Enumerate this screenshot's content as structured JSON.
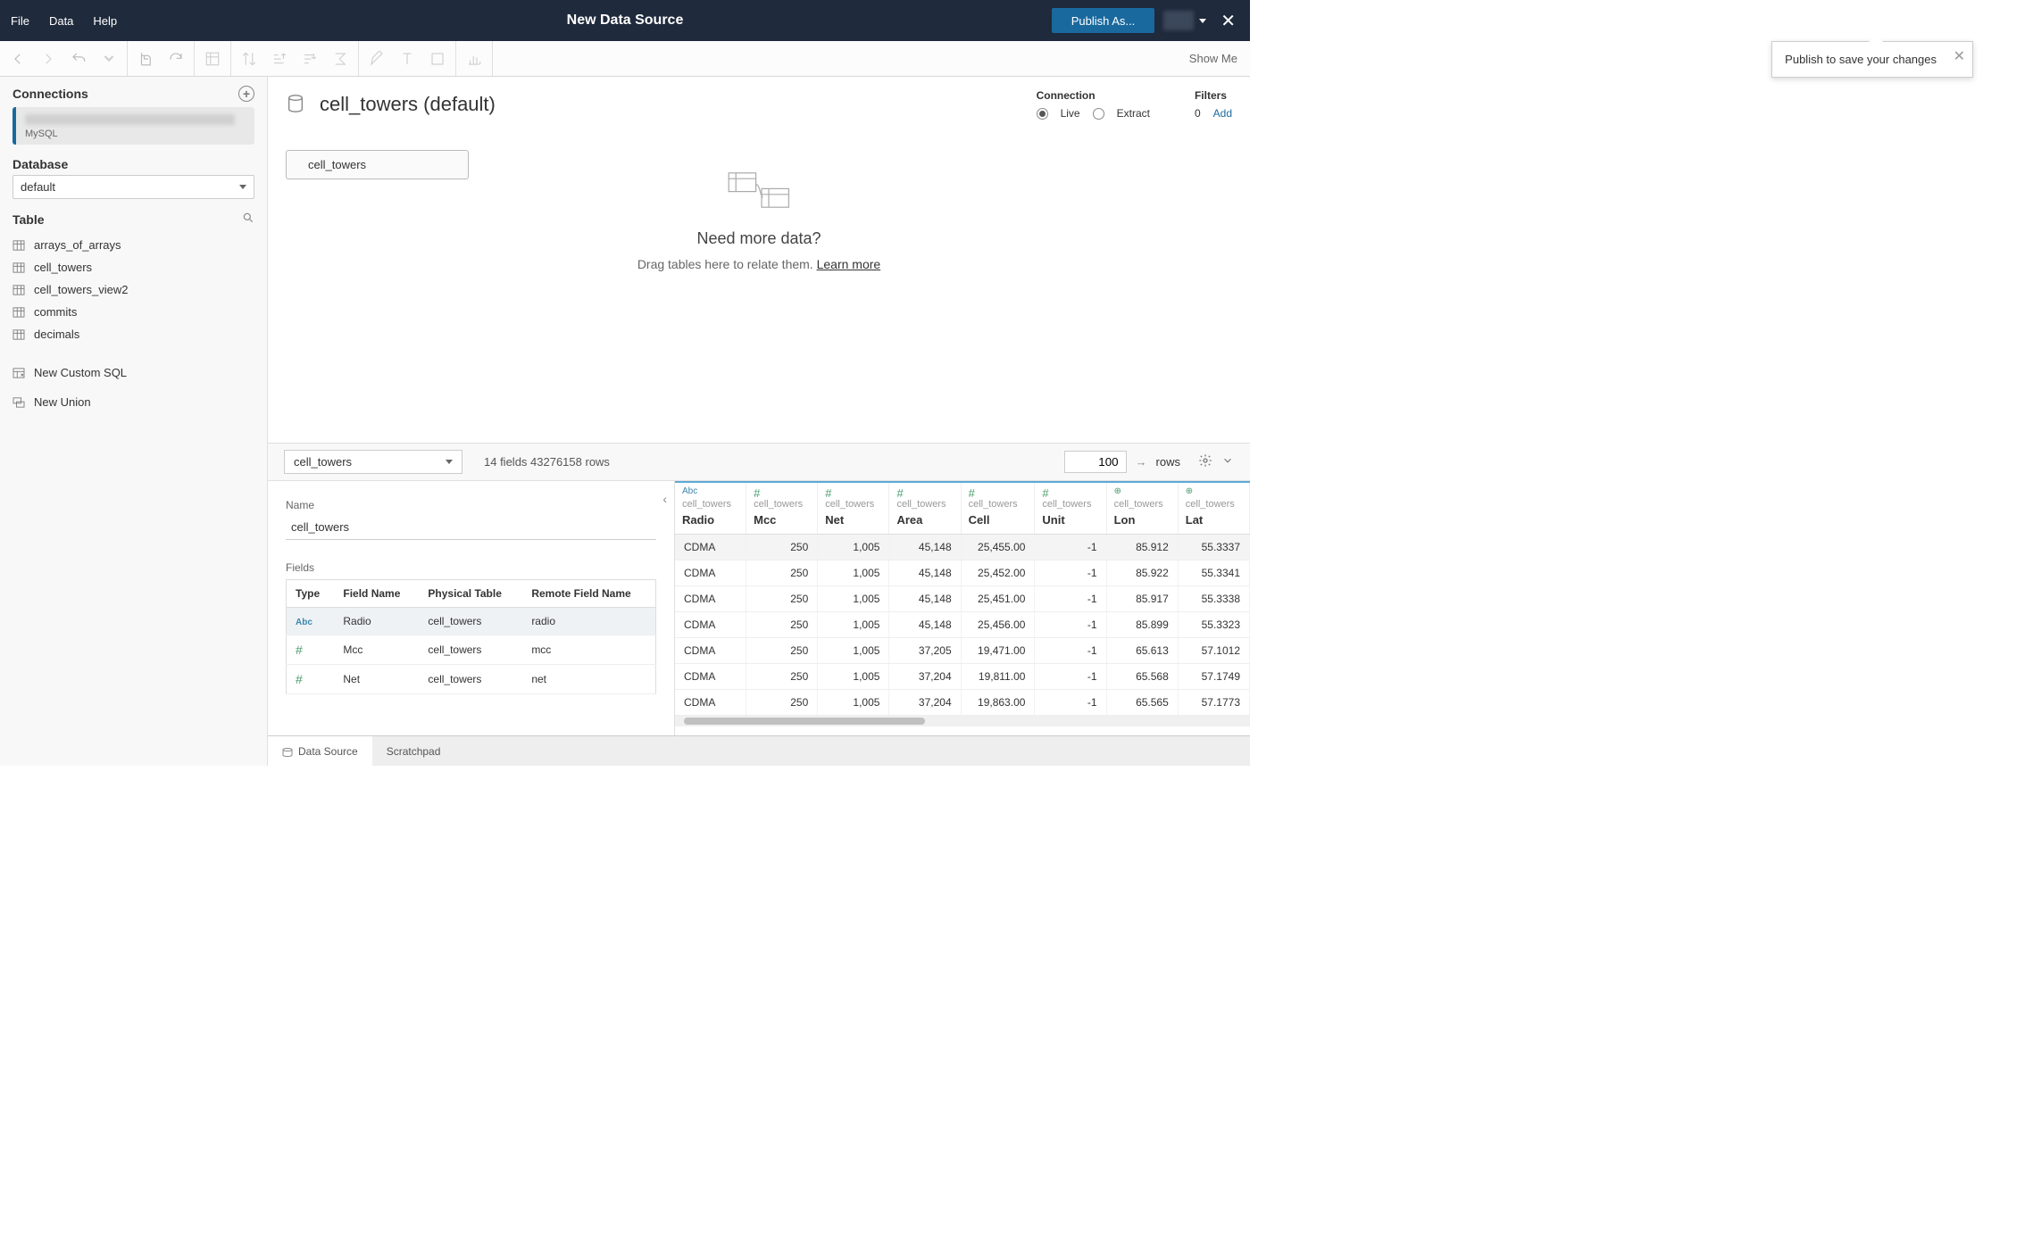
{
  "menubar": {
    "file": "File",
    "data": "Data",
    "help": "Help",
    "title": "New Data Source",
    "publish": "Publish As..."
  },
  "tooltip": {
    "text": "Publish to save your changes"
  },
  "toolbar": {
    "show_me": "Show Me"
  },
  "sidebar": {
    "connections": {
      "label": "Connections",
      "items": [
        {
          "type": "MySQL"
        }
      ]
    },
    "database": {
      "label": "Database",
      "value": "default"
    },
    "table": {
      "label": "Table",
      "items": [
        "arrays_of_arrays",
        "cell_towers",
        "cell_towers_view2",
        "commits",
        "decimals"
      ],
      "custom_sql": "New Custom SQL",
      "union": "New Union"
    }
  },
  "canvas": {
    "ds_title": "cell_towers (default)",
    "pill": "cell_towers",
    "connection": {
      "label": "Connection",
      "live": "Live",
      "extract": "Extract"
    },
    "filters": {
      "label": "Filters",
      "count": "0",
      "add": "Add"
    },
    "guide": {
      "headline": "Need more data?",
      "text": "Drag tables here to relate them. ",
      "link": "Learn more"
    }
  },
  "grid": {
    "selector": "cell_towers",
    "stats": "14 fields 43276158 rows",
    "rows_input": "100",
    "rows_label": "rows",
    "name_label": "Name",
    "name_value": "cell_towers",
    "fields_label": "Fields",
    "fields_header": {
      "type": "Type",
      "field_name": "Field Name",
      "phys": "Physical Table",
      "remote": "Remote Field Name"
    },
    "fields_rows": [
      {
        "type": "abc",
        "name": "Radio",
        "phys": "cell_towers",
        "remote": "radio"
      },
      {
        "type": "num",
        "name": "Mcc",
        "phys": "cell_towers",
        "remote": "mcc"
      },
      {
        "type": "num",
        "name": "Net",
        "phys": "cell_towers",
        "remote": "net"
      }
    ],
    "columns": [
      {
        "type": "abc",
        "src": "cell_towers",
        "name": "Radio",
        "numeric": false
      },
      {
        "type": "num",
        "src": "cell_towers",
        "name": "Mcc",
        "numeric": true
      },
      {
        "type": "num",
        "src": "cell_towers",
        "name": "Net",
        "numeric": true
      },
      {
        "type": "num",
        "src": "cell_towers",
        "name": "Area",
        "numeric": true
      },
      {
        "type": "num",
        "src": "cell_towers",
        "name": "Cell",
        "numeric": true
      },
      {
        "type": "num",
        "src": "cell_towers",
        "name": "Unit",
        "numeric": true
      },
      {
        "type": "geo",
        "src": "cell_towers",
        "name": "Lon",
        "numeric": true
      },
      {
        "type": "geo",
        "src": "cell_towers",
        "name": "Lat",
        "numeric": true
      }
    ],
    "data": [
      [
        "CDMA",
        "250",
        "1,005",
        "45,148",
        "25,455.00",
        "-1",
        "85.912",
        "55.3337"
      ],
      [
        "CDMA",
        "250",
        "1,005",
        "45,148",
        "25,452.00",
        "-1",
        "85.922",
        "55.3341"
      ],
      [
        "CDMA",
        "250",
        "1,005",
        "45,148",
        "25,451.00",
        "-1",
        "85.917",
        "55.3338"
      ],
      [
        "CDMA",
        "250",
        "1,005",
        "45,148",
        "25,456.00",
        "-1",
        "85.899",
        "55.3323"
      ],
      [
        "CDMA",
        "250",
        "1,005",
        "37,205",
        "19,471.00",
        "-1",
        "65.613",
        "57.1012"
      ],
      [
        "CDMA",
        "250",
        "1,005",
        "37,204",
        "19,811.00",
        "-1",
        "65.568",
        "57.1749"
      ],
      [
        "CDMA",
        "250",
        "1,005",
        "37,204",
        "19,863.00",
        "-1",
        "65.565",
        "57.1773"
      ]
    ]
  },
  "tabs": {
    "data_source": "Data Source",
    "scratchpad": "Scratchpad"
  }
}
